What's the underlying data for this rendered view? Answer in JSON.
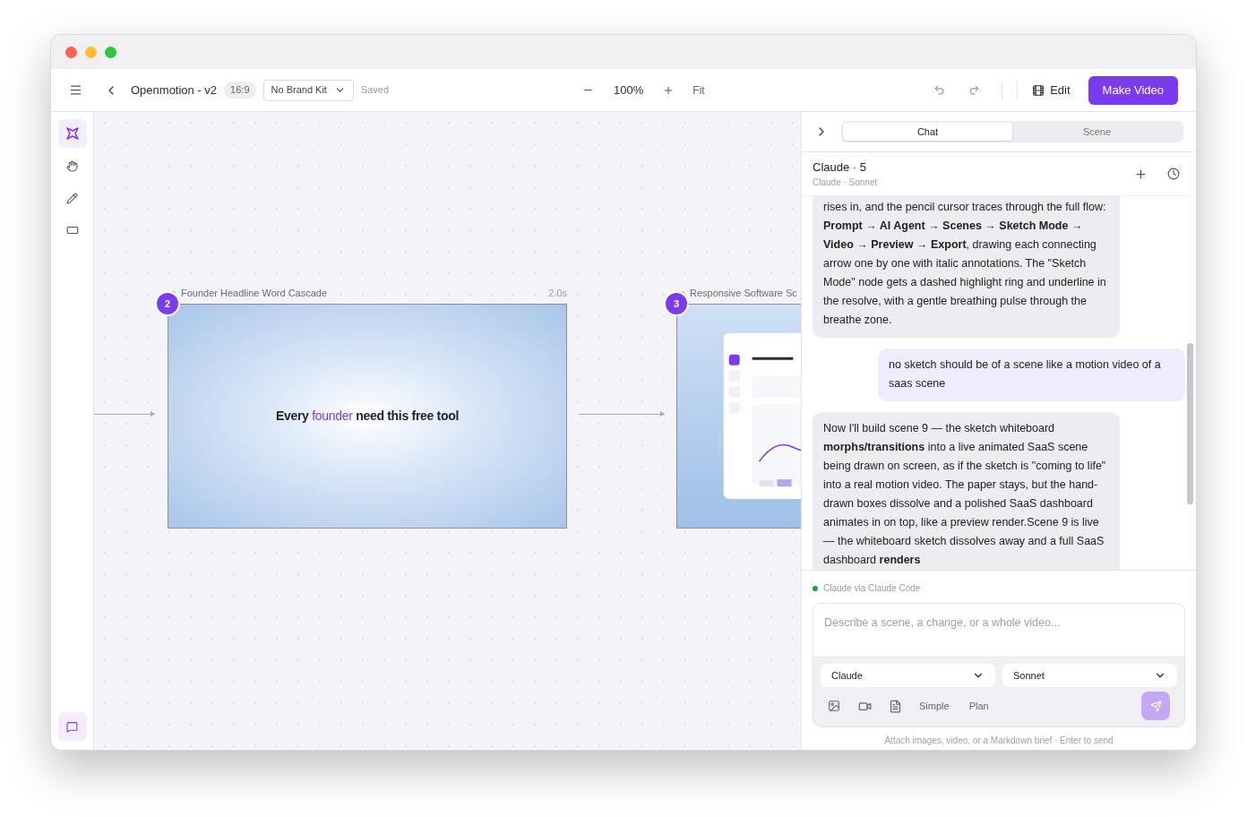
{
  "toolbar": {
    "title": "Openmotion - v2",
    "aspect": "16:9",
    "brand_kit": "No Brand Kit",
    "save_status": "Saved",
    "zoom": "100%",
    "fit": "Fit",
    "edit": "Edit",
    "make_video": "Make Video"
  },
  "tools": [
    {
      "selected": true
    },
    {
      "selected": false
    },
    {
      "selected": false
    },
    {
      "selected": false
    }
  ],
  "chat_toggle": {
    "selected": true
  },
  "canvas": {
    "scenes": [
      {
        "number": "2",
        "title": "Founder Headline Word Cascade",
        "duration": "2.0s",
        "kind": "headline",
        "headline": {
          "before": "Every",
          "highlight": "founder",
          "after": "need this free tool"
        }
      },
      {
        "number": "3",
        "title": "Responsive Software Sc",
        "kind": "picture"
      }
    ]
  },
  "panel": {
    "tabs": [
      {
        "label": "Chat",
        "selected": true
      },
      {
        "label": "Scene",
        "selected": false
      }
    ],
    "thread_title": "Claude · 5",
    "thread_subtitle": "Claude · Sonnet",
    "messages": [
      {
        "kind": "assistant",
        "text": "rises in, and the pencil cursor traces through the full flow: **Prompt → AI Agent → Scenes → Sketch Mode → Video → Preview → Export**, drawing each connecting arrow one by one with italic annotations. The \"Sketch Mode\" node gets a dashed highlight ring and underline in the resolve, with a gentle breathing pulse through the breathe zone."
      },
      {
        "kind": "user",
        "text": "no sketch should be of a scene like a motion video of a saas scene"
      },
      {
        "kind": "assistant",
        "text": "Now I'll build scene 9 — the sketch whiteboard **morphs/transitions** into a live animated SaaS scene being drawn on screen, as if the sketch is \"coming to life\" into a real motion video. The paper stays, but the hand-drawn boxes dissolve and a polished SaaS dashboard animates in on top, like a preview render.Scene 9 is live — the whiteboard sketch dissolves away and a full SaaS dashboard **renders**"
      }
    ],
    "status": {
      "text": "Claude via Claude Code",
      "color": "#22a03a"
    },
    "composer": {
      "placeholder": "Describe a scene, a change, or a whole video...",
      "provider": "Claude",
      "model": "Sonnet",
      "simple": "Simple",
      "plan": "Plan",
      "send_disabled": true
    },
    "hint": "Attach images, video, or a Markdown brief · Enter to send"
  }
}
